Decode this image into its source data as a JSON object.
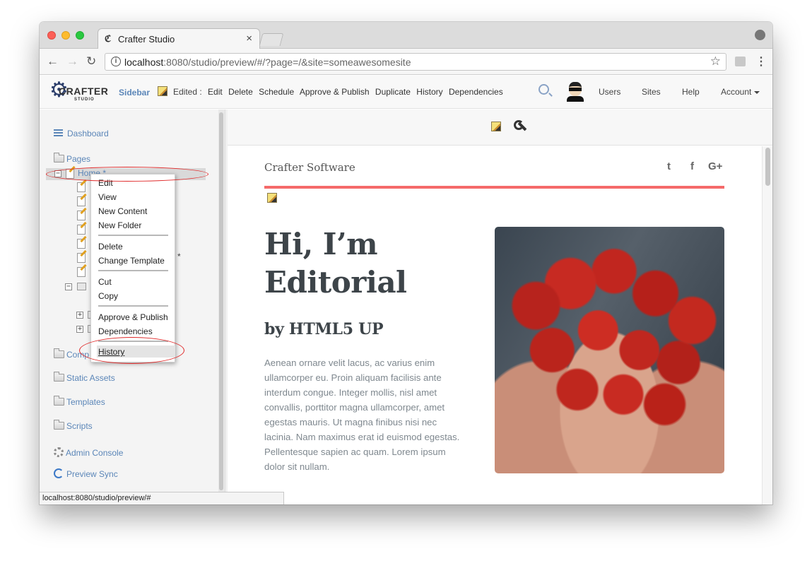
{
  "browser": {
    "tab_title": "Crafter Studio",
    "tab_close": "×",
    "url_host": "localhost",
    "url_rest": ":8080/studio/preview/#/?page=/&site=someawesomesite",
    "status_url": "localhost:8080/studio/preview/#"
  },
  "toolbar": {
    "logo_text": "CRAFTER",
    "logo_sub": "STUDIO",
    "sidebar_label": "Sidebar",
    "edited_label": "Edited :",
    "actions": [
      "Edit",
      "Delete",
      "Schedule",
      "Approve & Publish",
      "Duplicate",
      "History",
      "Dependencies"
    ],
    "users": "Users",
    "sites": "Sites",
    "help": "Help",
    "account": "Account"
  },
  "sidebar": {
    "dashboard": "Dashboard",
    "pages": "Pages",
    "home": "Home *",
    "components": "Comp",
    "static_assets": "Static Assets",
    "templates": "Templates",
    "scripts": "Scripts",
    "admin_console": "Admin Console",
    "preview_sync": "Preview Sync",
    "tree_asterisk": "*"
  },
  "context_menu": {
    "edit": "Edit",
    "view": "View",
    "new_content": "New Content",
    "new_folder": "New Folder",
    "delete": "Delete",
    "change_template": "Change Template",
    "cut": "Cut",
    "copy": "Copy",
    "approve_publish": "Approve & Publish",
    "dependencies": "Dependencies",
    "history": "History"
  },
  "preview": {
    "brand": "Crafter Software",
    "social": [
      "t",
      "f",
      "G+"
    ],
    "headline": "Hi, I’m Editorial",
    "subhead": "by HTML5 UP",
    "paragraph": "Aenean ornare velit lacus, ac varius enim ullamcorper eu. Proin aliquam facilisis ante interdum congue. Integer mollis, nisl amet convallis, porttitor magna ullamcorper, amet egestas mauris. Ut magna finibus nisi nec lacinia. Nam maximus erat id euismod egestas. Pellentesque sapien ac quam. Lorem ipsum dolor sit nullam."
  },
  "colors": {
    "accent_red": "#f56a6a",
    "link_blue": "#5b86b8",
    "highlight_circle": "#e02a2a"
  }
}
